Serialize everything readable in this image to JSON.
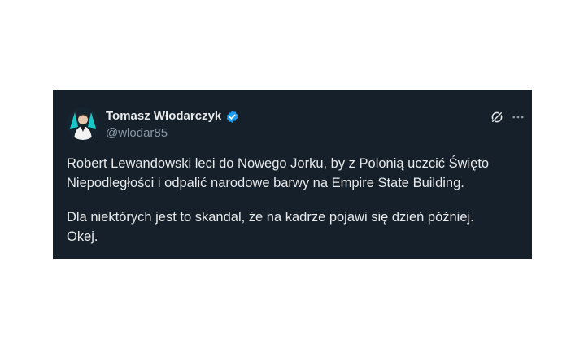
{
  "author": {
    "display_name": "Tomasz Włodarczyk",
    "handle": "@wlodar85",
    "verified": true,
    "verified_color": "#1d9bf0"
  },
  "icons": {
    "verified": "verified-badge-icon",
    "grok": "grok-icon",
    "more": "more-icon"
  },
  "tweet": {
    "lines": [
      "Robert Lewandowski leci do Nowego Jorku, by z Polonią uczcić Święto",
      "Niepodległości i odpalić narodowe barwy na Empire State Building.",
      "Dla niektórych jest to skandal, że na kadrze pojawi się dzień później.",
      "Okej."
    ]
  },
  "colors": {
    "card_background": "#15202b",
    "text_primary": "#e7e9ea",
    "text_secondary": "#8b98a5"
  }
}
